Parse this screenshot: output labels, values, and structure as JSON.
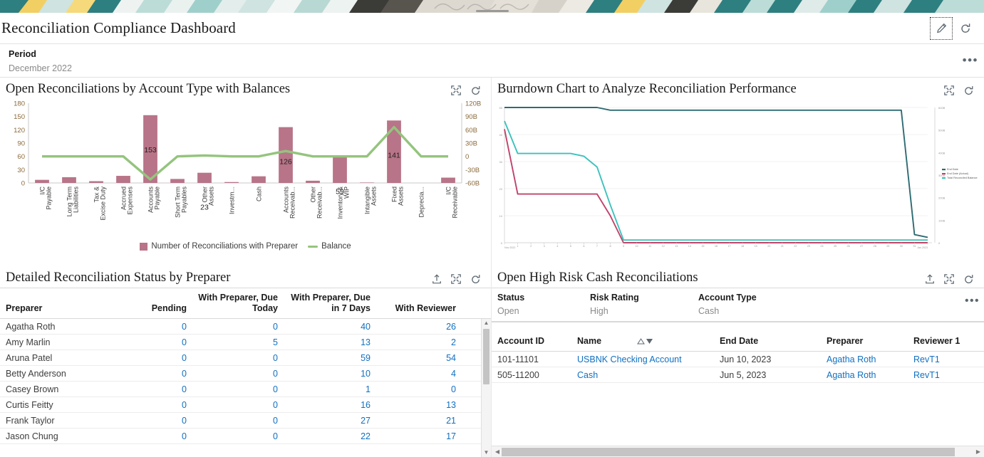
{
  "header": {
    "title": "Reconciliation Compliance Dashboard",
    "edit_icon": "pencil-icon",
    "refresh_icon": "refresh-icon"
  },
  "period": {
    "label": "Period",
    "value": "December 2022",
    "more_glyph": "•••"
  },
  "panels": {
    "bar": {
      "title": "Open Reconciliations by Account Type with Balances",
      "maximize_icon": "maximize-icon",
      "refresh_icon": "refresh-icon"
    },
    "burndown": {
      "title": "Burndown Chart to Analyze Reconciliation Performance",
      "maximize_icon": "maximize-icon",
      "refresh_icon": "refresh-icon"
    },
    "detail": {
      "title": "Detailed Reconciliation Status by Preparer",
      "export_icon": "export-icon",
      "maximize_icon": "maximize-icon",
      "refresh_icon": "refresh-icon"
    },
    "highrisk": {
      "title": "Open High Risk Cash Reconciliations",
      "export_icon": "export-icon",
      "maximize_icon": "maximize-icon",
      "refresh_icon": "refresh-icon",
      "more_glyph": "•••"
    }
  },
  "chart_data": [
    {
      "id": "open-reconciliations-bar",
      "type": "bar",
      "title": "Open Reconciliations by Account Type with Balances",
      "xlabel": "",
      "ylabel": "",
      "ylim": [
        0,
        180
      ],
      "y2lim": [
        -60,
        120
      ],
      "grid": false,
      "legend_position": "bottom",
      "yticks": [
        "0",
        "30",
        "60",
        "90",
        "120",
        "150",
        "180"
      ],
      "y2ticks": [
        "-60B",
        "-30B",
        "0",
        "30B",
        "60B",
        "90B",
        "120B"
      ],
      "categories": [
        "I/C Payable",
        "Long Term Liabilities",
        "Tax & Excise Duty",
        "Accrued Expenses",
        "Accounts Payable",
        "Short Term Payables",
        "Other Assets",
        "Investm...",
        "Cash",
        "Accounts Receivab...",
        "Other Receivab...",
        "Inventory & WIP",
        "Intangible Assets",
        "Fixed Assets",
        "Deprecia...",
        "I/C Receivable"
      ],
      "series": [
        {
          "name": "Number of Reconciliations with Preparer",
          "type": "bar",
          "color": "#b87488",
          "values": [
            7,
            13,
            4,
            16,
            153,
            9,
            23,
            2,
            15,
            126,
            5,
            59,
            1,
            141,
            0,
            12
          ],
          "labeled": [
            null,
            null,
            null,
            null,
            "153",
            null,
            "23",
            null,
            null,
            "126",
            null,
            "59",
            null,
            "141",
            null,
            null
          ]
        },
        {
          "name": "Balance",
          "type": "line",
          "color": "#94c47d",
          "axis": "right",
          "values": [
            0,
            0,
            0,
            0,
            -52,
            0,
            2,
            0,
            0,
            12,
            0,
            0,
            0,
            66,
            0,
            0
          ]
        }
      ]
    },
    {
      "id": "burndown-chart",
      "type": "line",
      "title": "Burndown Chart to Analyze Reconciliation Performance",
      "xlabel": "",
      "ylabel": "",
      "ylim": [
        0,
        50
      ],
      "y2lim": [
        0,
        600
      ],
      "grid": true,
      "legend_position": "right",
      "yticks": [
        "0",
        "10",
        "20",
        "30",
        "40",
        "50"
      ],
      "y2ticks": [
        "0",
        "100B",
        "200B",
        "300B",
        "400B",
        "500B",
        "600B"
      ],
      "x": [
        "Nov 2022",
        "1",
        "2",
        "3",
        "4",
        "5",
        "6",
        "7",
        "8",
        "9",
        "10",
        "11",
        "12",
        "13",
        "14",
        "15",
        "16",
        "17",
        "18",
        "19",
        "20",
        "21",
        "22",
        "23",
        "24",
        "25",
        "26",
        "27",
        "28",
        "29",
        "30",
        "31",
        "Jan 2023"
      ],
      "series": [
        {
          "name": "End Date",
          "color": "#2d6b72",
          "values": [
            50,
            50,
            50,
            50,
            50,
            50,
            50,
            50,
            49,
            49,
            49,
            49,
            49,
            49,
            49,
            49,
            49,
            49,
            49,
            49,
            49,
            49,
            49,
            49,
            49,
            49,
            49,
            49,
            49,
            49,
            49,
            3,
            2
          ]
        },
        {
          "name": "End Date (Actual)",
          "color": "#c0436a",
          "values": [
            42,
            18,
            18,
            18,
            18,
            18,
            18,
            18,
            10,
            0,
            0,
            0,
            0,
            0,
            0,
            0,
            0,
            0,
            0,
            0,
            0,
            0,
            0,
            0,
            0,
            0,
            0,
            0,
            0,
            0,
            0,
            0,
            0
          ]
        },
        {
          "name": "Total Reconciled Balance",
          "color": "#3cc2bd",
          "values": [
            45,
            33,
            33,
            33,
            33,
            33,
            32,
            28,
            14,
            1,
            1,
            1,
            1,
            1,
            1,
            1,
            1,
            1,
            1,
            1,
            1,
            1,
            1,
            1,
            1,
            1,
            1,
            1,
            1,
            1,
            1,
            1,
            1
          ]
        }
      ]
    }
  ],
  "bar_legend": {
    "bar_label": "Number of Reconciliations with Preparer",
    "line_label": "Balance"
  },
  "detail_table": {
    "columns": [
      "Preparer",
      "Pending",
      "With Preparer, Due Today",
      "With Preparer, Due in 7 Days",
      "With Reviewer"
    ],
    "rows": [
      {
        "preparer": "Agatha Roth",
        "pending": "0",
        "due_today": "0",
        "due_7": "40",
        "with_reviewer": "26"
      },
      {
        "preparer": "Amy Marlin",
        "pending": "0",
        "due_today": "5",
        "due_7": "13",
        "with_reviewer": "2"
      },
      {
        "preparer": "Aruna Patel",
        "pending": "0",
        "due_today": "0",
        "due_7": "59",
        "with_reviewer": "54"
      },
      {
        "preparer": "Betty Anderson",
        "pending": "0",
        "due_today": "0",
        "due_7": "10",
        "with_reviewer": "4"
      },
      {
        "preparer": "Casey Brown",
        "pending": "0",
        "due_today": "0",
        "due_7": "1",
        "with_reviewer": "0"
      },
      {
        "preparer": "Curtis Feitty",
        "pending": "0",
        "due_today": "0",
        "due_7": "16",
        "with_reviewer": "13"
      },
      {
        "preparer": "Frank Taylor",
        "pending": "0",
        "due_today": "0",
        "due_7": "27",
        "with_reviewer": "21"
      },
      {
        "preparer": "Jason Chung",
        "pending": "0",
        "due_today": "0",
        "due_7": "22",
        "with_reviewer": "17"
      }
    ]
  },
  "highrisk_filters": [
    {
      "label": "Status",
      "value": "Open"
    },
    {
      "label": "Risk Rating",
      "value": "High"
    },
    {
      "label": "Account Type",
      "value": "Cash"
    }
  ],
  "highrisk_table": {
    "columns": [
      "Account ID",
      "Name",
      "End Date",
      "Preparer",
      "Reviewer 1"
    ],
    "sort_asc_icon": "sort-ascending-icon",
    "sort_desc_icon": "sort-descending-icon",
    "rows": [
      {
        "account_id": "101-11101",
        "name": "USBNK Checking Account",
        "end_date": "Jun 10, 2023",
        "preparer": "Agatha Roth",
        "reviewer": "RevT1"
      },
      {
        "account_id": "505-11200",
        "name": "Cash",
        "end_date": "Jun 5, 2023",
        "preparer": "Agatha Roth",
        "reviewer": "RevT1"
      }
    ]
  },
  "scroll": {
    "up_glyph": "▲",
    "down_glyph": "▼",
    "left_glyph": "◀",
    "right_glyph": "▶"
  },
  "colors": {
    "bar": "#b87488",
    "balance_line": "#94c47d",
    "end_date": "#2d6b72",
    "end_date_actual": "#c0436a",
    "reconciled_balance": "#3cc2bd",
    "link": "#1170c1"
  }
}
